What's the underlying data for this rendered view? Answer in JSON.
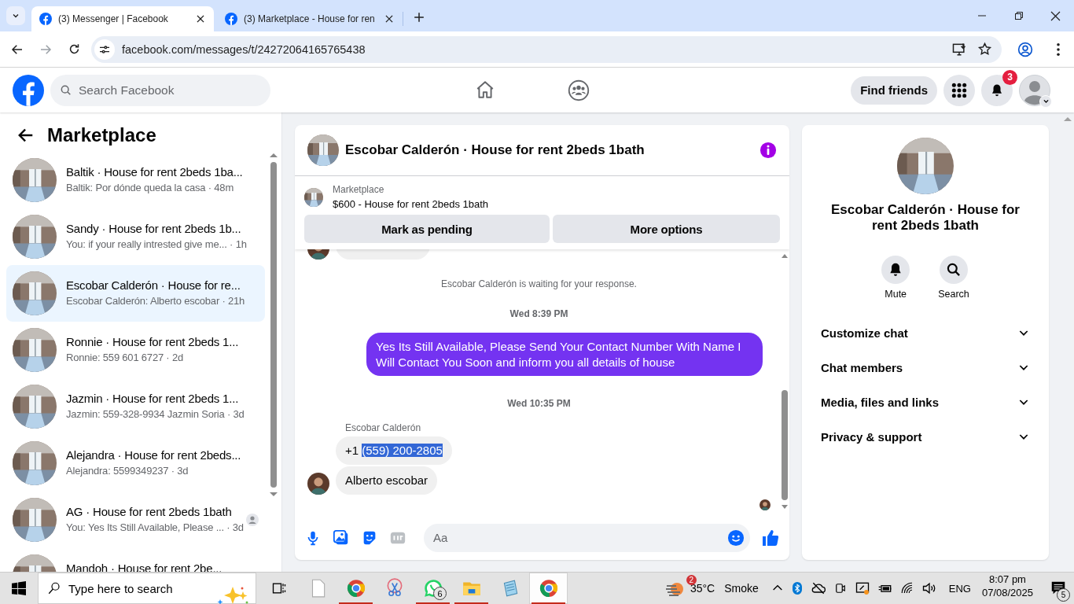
{
  "browser": {
    "tabs": [
      {
        "title": "(3) Messenger | Facebook",
        "selected": true
      },
      {
        "title": "(3) Marketplace - House for ren",
        "selected": false
      }
    ],
    "url": "facebook.com/messages/t/24272064165765438"
  },
  "header": {
    "search_placeholder": "Search Facebook",
    "find_friends": "Find friends",
    "notification_count": "3"
  },
  "sidebar": {
    "title": "Marketplace",
    "conversations": [
      {
        "title": "Baltik · House for rent 2beds 1ba...",
        "preview": "Baltik: Por dónde queda la casa · 48m",
        "selected": false
      },
      {
        "title": "Sandy · House for rent 2beds 1b...",
        "preview": "You: if your really intrested give me... · 1h",
        "selected": false
      },
      {
        "title": "Escobar Calderón · House for re...",
        "preview": "Escobar Calderón: Alberto escobar · 21h",
        "selected": true
      },
      {
        "title": "Ronnie · House for rent 2beds 1...",
        "preview": "Ronnie: 559 601 6727 · 2d",
        "selected": false
      },
      {
        "title": "Jazmin · House for rent 2beds 1...",
        "preview": "Jazmin: 559-328-9934 Jazmin Soria · 3d",
        "selected": false
      },
      {
        "title": "Alejandra · House for rent 2beds...",
        "preview": "Alejandra: 5599349237 · 3d",
        "selected": false
      },
      {
        "title": "AG · House for rent 2beds 1bath",
        "preview": "You: Yes Its Still Available, Please ... · 3d",
        "selected": false,
        "seen": true
      },
      {
        "title": "Mandoh · House for rent 2be...",
        "selected": false
      }
    ]
  },
  "chat": {
    "title": "Escobar Calderón · House for rent 2beds 1bath",
    "listing": {
      "label": "Marketplace",
      "title": "$600 - House for rent 2beds 1bath"
    },
    "actions": [
      "Mark as pending",
      "More options"
    ],
    "messages": [
      {
        "kind": "partial"
      },
      {
        "kind": "notice",
        "text": "Escobar Calderón is waiting for your response."
      },
      {
        "kind": "time",
        "text": "Wed 8:39 PM"
      },
      {
        "kind": "outgoing",
        "text": "Yes Its Still Available, Please Send Your Contact Number With Name I Will Contact You Soon and inform you all details of house"
      },
      {
        "kind": "time",
        "text": "Wed 10:35 PM"
      },
      {
        "kind": "sender",
        "text": "Escobar Calderón"
      },
      {
        "kind": "incoming",
        "text": "+1",
        "highlighted_text": "(559) 200-2805",
        "avatar": false
      },
      {
        "kind": "incoming",
        "text": "Alberto escobar",
        "avatar": true
      }
    ],
    "composer_placeholder": "Aa"
  },
  "info": {
    "name": "Escobar Calderón · House for rent 2beds 1bath",
    "actions": [
      {
        "kind": "mute",
        "label": "Mute"
      },
      {
        "kind": "search",
        "label": "Search"
      }
    ],
    "sections": [
      "Customize chat",
      "Chat members",
      "Media, files and links",
      "Privacy & support"
    ]
  },
  "taskbar": {
    "search_placeholder": "Type here to search",
    "apps": [
      {
        "kind": "file",
        "running": false,
        "selected": false
      },
      {
        "kind": "chrome",
        "running": true,
        "selected": false
      },
      {
        "kind": "snip",
        "running": false,
        "selected": false
      },
      {
        "kind": "whatsapp",
        "running": true,
        "selected": false,
        "badge": "6"
      },
      {
        "kind": "folder",
        "running": true,
        "selected": false
      },
      {
        "kind": "notepad",
        "running": false,
        "selected": false
      },
      {
        "kind": "chrome",
        "running": true,
        "selected": true
      }
    ],
    "weather": {
      "badge": "2",
      "temperature": "35°C",
      "condition": "Smoke"
    },
    "language": "ENG",
    "time": "8:07 pm",
    "date": "07/08/2025",
    "notification_count": "5"
  }
}
